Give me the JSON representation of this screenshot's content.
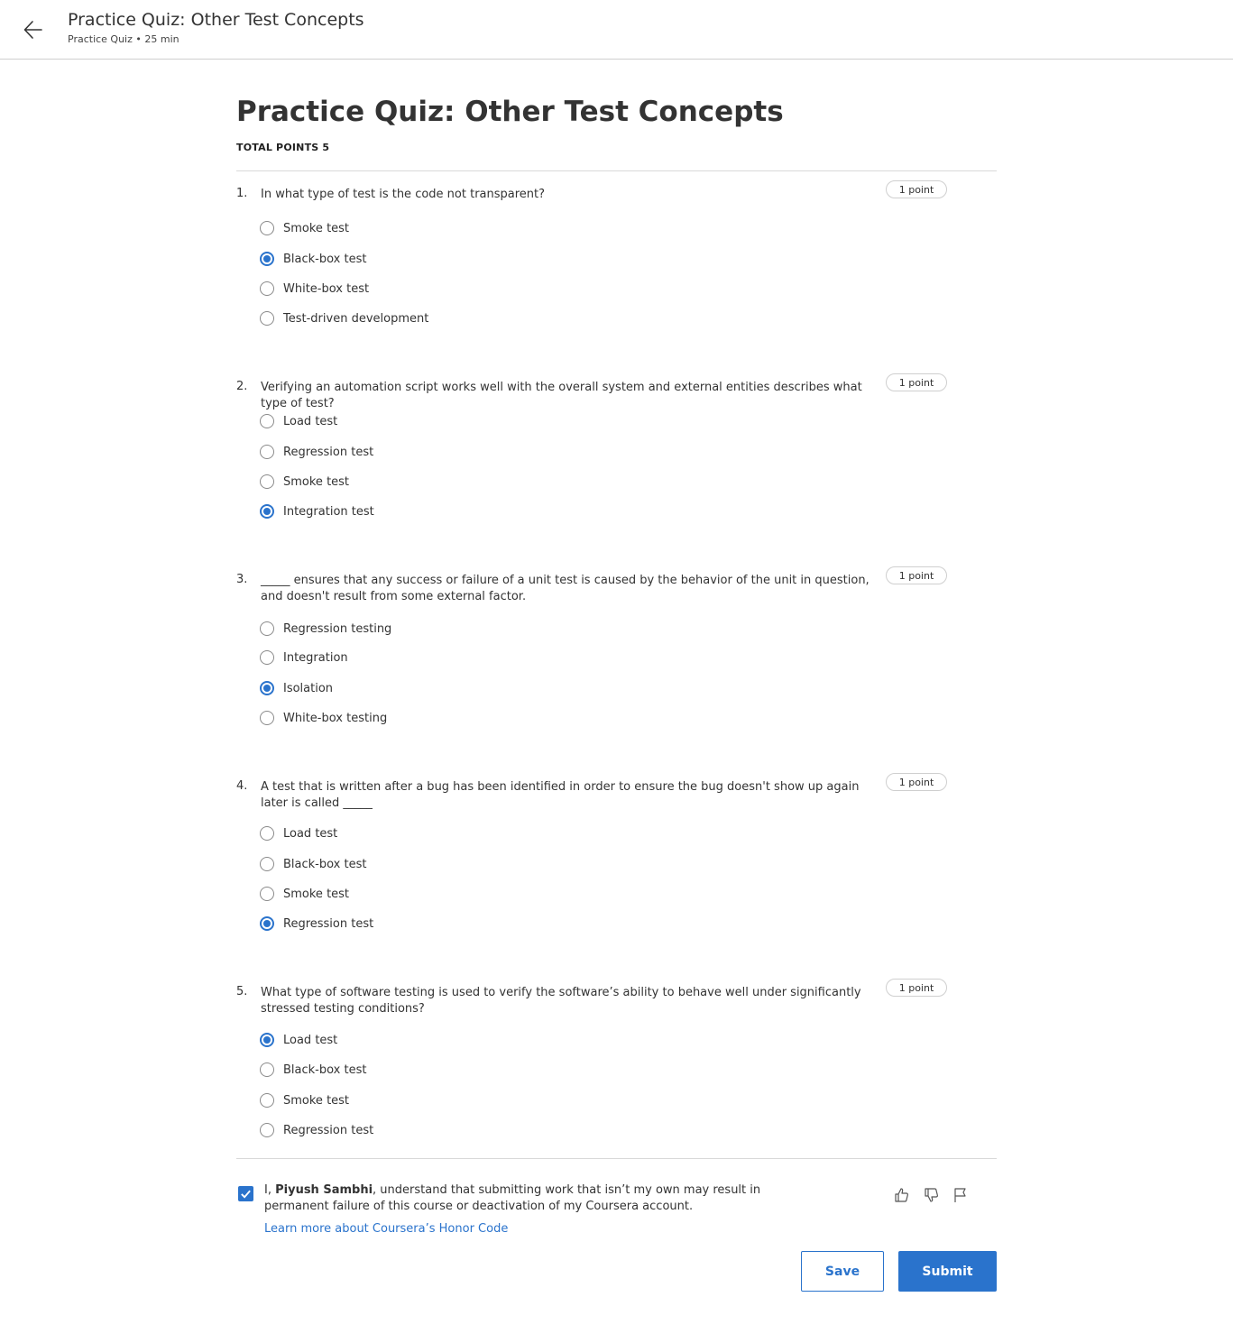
{
  "header": {
    "title": "Practice Quiz: Other Test Concepts",
    "subtitle": "Practice Quiz • 25 min"
  },
  "main": {
    "title": "Practice Quiz: Other Test Concepts",
    "total_points": "TOTAL POINTS 5"
  },
  "questions": [
    {
      "number": "1.",
      "text": "In what type of test is the code not transparent?",
      "points": "1 point",
      "options": [
        "Smoke test",
        "Black-box test",
        "White-box test",
        "Test-driven development"
      ],
      "selected": 1
    },
    {
      "number": "2.",
      "text": "Verifying an automation script works well with the overall system and external entities describes what type of test?",
      "points": "1 point",
      "options": [
        "Load test",
        "Regression test",
        "Smoke test",
        "Integration test"
      ],
      "selected": 3
    },
    {
      "number": "3.",
      "text": "_____ ensures that any success or failure of a unit test is caused by the behavior of the unit in question, and doesn't result from some external factor.",
      "points": "1 point",
      "options": [
        "Regression testing",
        "Integration",
        "Isolation",
        "White-box testing"
      ],
      "selected": 2
    },
    {
      "number": "4.",
      "text": "A test that is written after a bug has been identified in order to ensure the bug doesn't show up again later is called _____",
      "points": "1 point",
      "options": [
        "Load test",
        "Black-box test",
        "Smoke test",
        "Regression test"
      ],
      "selected": 3
    },
    {
      "number": "5.",
      "text": "What type of software testing is used to verify the software’s ability to behave well under significantly stressed testing conditions?",
      "points": "1 point",
      "options": [
        "Load test",
        "Black-box test",
        "Smoke test",
        "Regression test"
      ],
      "selected": 0
    }
  ],
  "honor": {
    "prefix": "I, ",
    "name": "Piyush Sambhi",
    "suffix": ", understand that submitting work that isn’t my own may result in permanent failure of this course or deactivation of my Coursera account.",
    "link": "Learn more about Coursera’s Honor Code",
    "checked": true
  },
  "actions": {
    "save_label": "Save",
    "submit_label": "Submit"
  },
  "colors": {
    "accent": "#2a73cc"
  }
}
